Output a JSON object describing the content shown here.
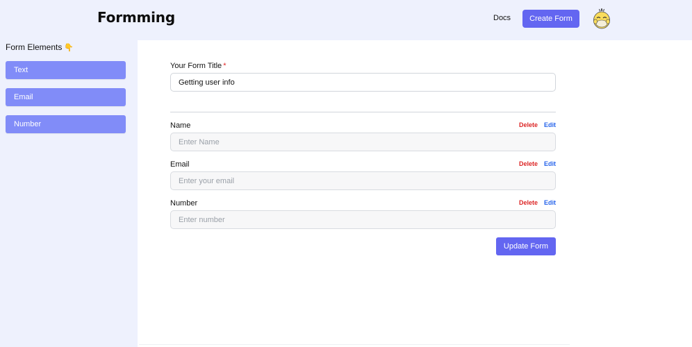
{
  "header": {
    "logo": "Formming",
    "docs_label": "Docs",
    "create_label": "Create Form"
  },
  "sidebar": {
    "title": "Form Elements",
    "hand_emoji": "👇",
    "items": [
      {
        "label": "Text"
      },
      {
        "label": "Email"
      },
      {
        "label": "Number"
      }
    ]
  },
  "form": {
    "title_label": "Your Form Title",
    "required_mark": "*",
    "title_value": "Getting user info",
    "fields": [
      {
        "label": "Name",
        "placeholder": "Enter Name",
        "delete_label": "Delete",
        "edit_label": "Edit"
      },
      {
        "label": "Email",
        "placeholder": "Enter your email",
        "delete_label": "Delete",
        "edit_label": "Edit"
      },
      {
        "label": "Number",
        "placeholder": "Enter number",
        "delete_label": "Delete",
        "edit_label": "Edit"
      }
    ],
    "update_label": "Update Form"
  },
  "colors": {
    "accent": "#6366f1",
    "sidebar_button": "#818cf8",
    "background": "#eef1fd",
    "delete": "#dc2626",
    "edit": "#2563eb"
  },
  "icons": {
    "avatar": "duck-avatar-icon",
    "hand": "pointing-down-hand-icon"
  }
}
